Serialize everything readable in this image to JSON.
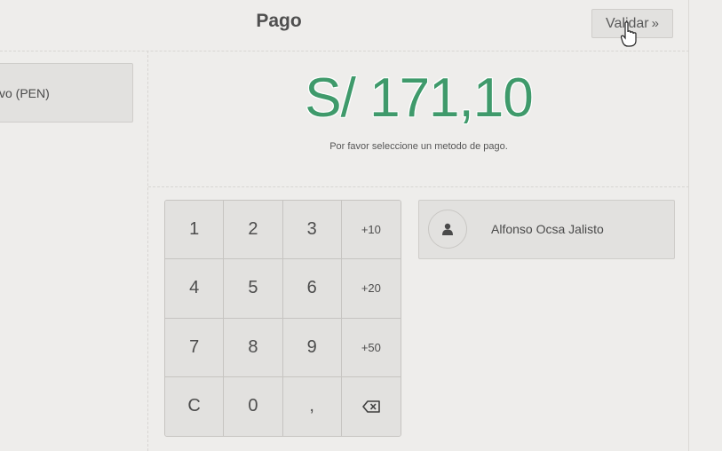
{
  "header": {
    "title": "Pago",
    "validate_label": "Validar",
    "validate_icon": "double-chevron-right-icon"
  },
  "payment_methods": [
    {
      "label": "vo (PEN)"
    }
  ],
  "summary": {
    "amount": "S/ 171,10",
    "hint": "Por favor seleccione un metodo de pago."
  },
  "numpad": {
    "keys": [
      "1",
      "2",
      "3",
      "+10",
      "4",
      "5",
      "6",
      "+20",
      "7",
      "8",
      "9",
      "+50",
      "C",
      "0",
      ",",
      "⌫"
    ]
  },
  "customer": {
    "name": "Alfonso Ocsa Jalisto",
    "icon": "user-icon"
  },
  "colors": {
    "amount": "#3f9a6b",
    "background": "#eeedeb",
    "button": "#e2e1df"
  }
}
